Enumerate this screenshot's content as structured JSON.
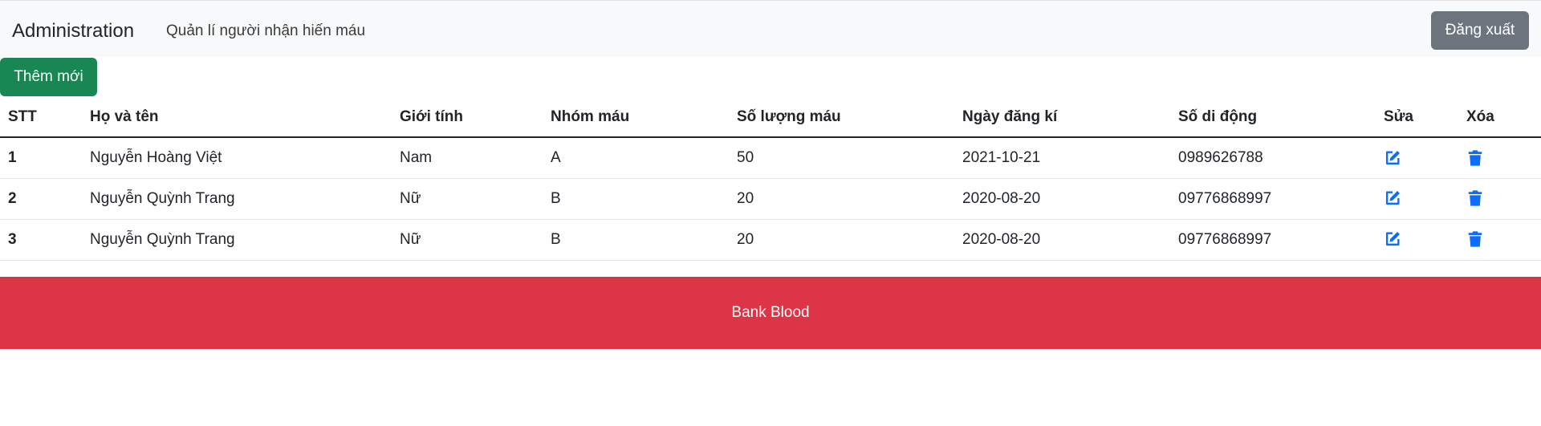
{
  "navbar": {
    "brand": "Administration",
    "link": "Quản lí người nhận hiến máu",
    "logout_label": "Đăng xuất"
  },
  "toolbar": {
    "add_label": "Thêm mới"
  },
  "table": {
    "headers": [
      "STT",
      "Họ và tên",
      "Giới tính",
      "Nhóm máu",
      "Số lượng máu",
      "Ngày đăng kí",
      "Số di động",
      "Sửa",
      "Xóa"
    ],
    "rows": [
      {
        "stt": "1",
        "name": "Nguyễn Hoàng Việt",
        "gender": "Nam",
        "blood_group": "A",
        "amount": "50",
        "date": "2021-10-21",
        "phone": "0989626788"
      },
      {
        "stt": "2",
        "name": "Nguyễn Quỳnh Trang",
        "gender": "Nữ",
        "blood_group": "B",
        "amount": "20",
        "date": "2020-08-20",
        "phone": "09776868997"
      },
      {
        "stt": "3",
        "name": "Nguyễn Quỳnh Trang",
        "gender": "Nữ",
        "blood_group": "B",
        "amount": "20",
        "date": "2020-08-20",
        "phone": "09776868997"
      }
    ],
    "edit_icon": "edit-icon",
    "delete_icon": "trash-icon"
  },
  "footer": {
    "text": "Bank Blood"
  },
  "colors": {
    "navbar_bg": "#f8f9fa",
    "logout_bg": "#6c757d",
    "add_bg": "#198754",
    "icon_blue": "#0d6efd",
    "footer_bg": "#dc3545"
  }
}
